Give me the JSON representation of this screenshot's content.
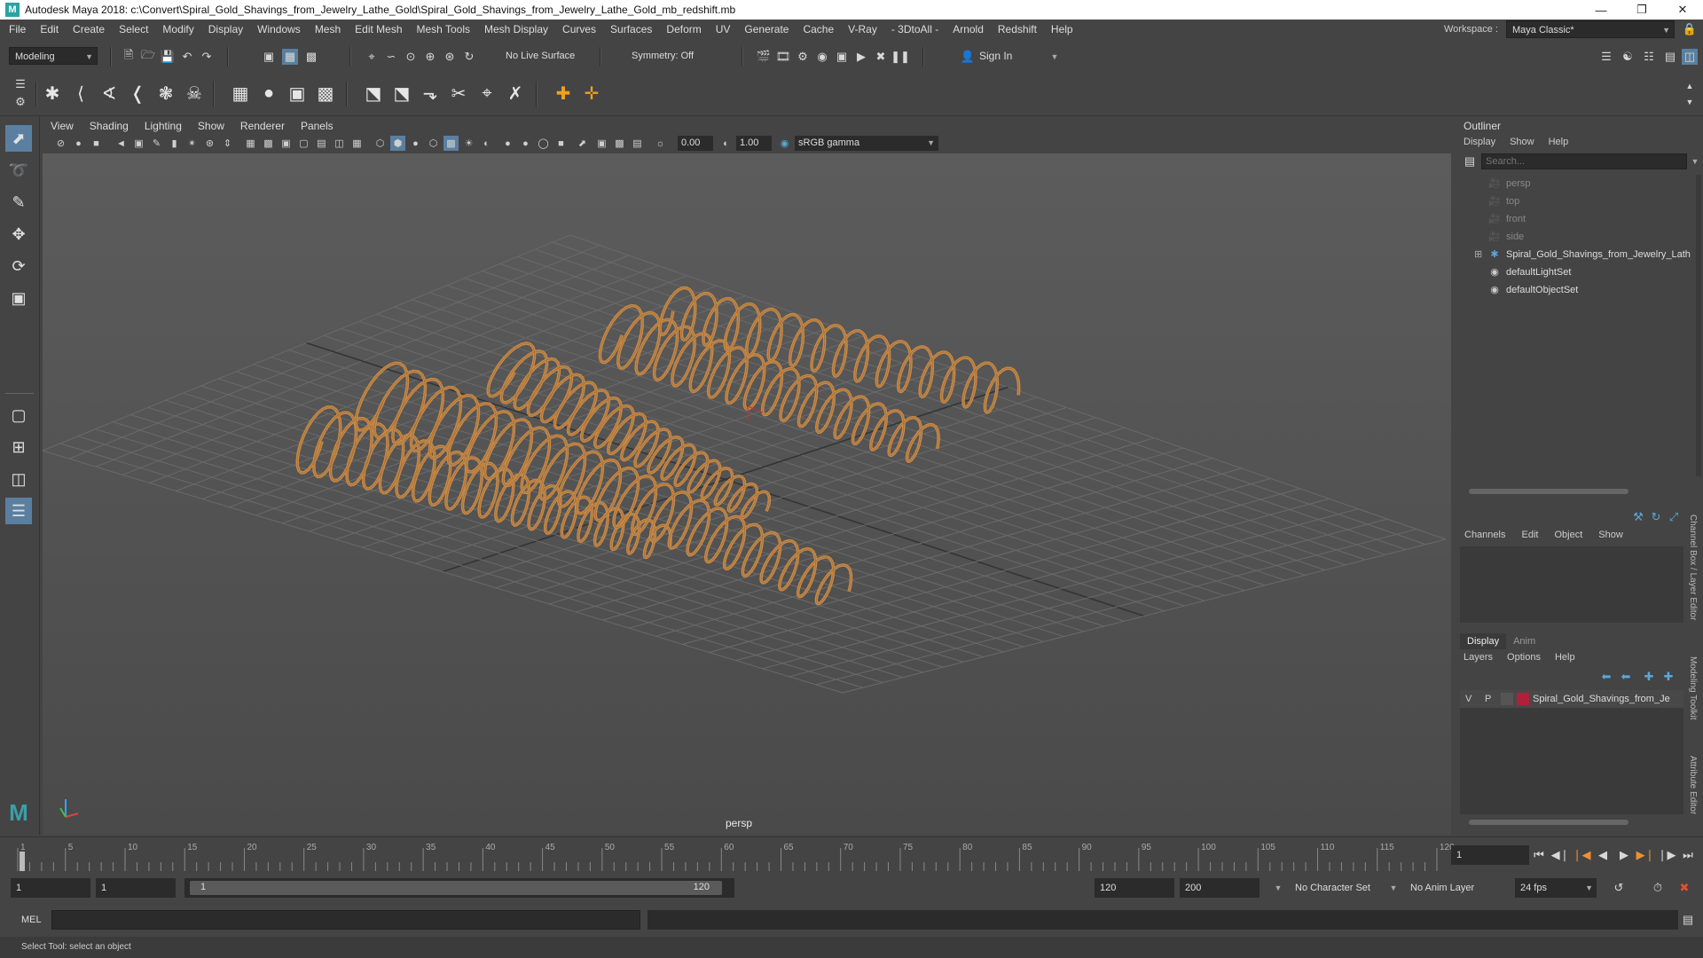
{
  "window": {
    "title": "Autodesk Maya 2018: c:\\Convert\\Spiral_Gold_Shavings_from_Jewelry_Lathe_Gold\\Spiral_Gold_Shavings_from_Jewelry_Lathe_Gold_mb_redshift.mb",
    "logo": "M"
  },
  "menus": [
    "File",
    "Edit",
    "Create",
    "Select",
    "Modify",
    "Display",
    "Windows",
    "Mesh",
    "Edit Mesh",
    "Mesh Tools",
    "Mesh Display",
    "Curves",
    "Surfaces",
    "Deform",
    "UV",
    "Generate",
    "Cache",
    "V-Ray",
    "- 3DtoAll -",
    "Arnold",
    "Redshift",
    "Help"
  ],
  "workspace": {
    "label": "Workspace :",
    "value": "Maya Classic*"
  },
  "status": {
    "mode": "Modeling",
    "live_surface": "No Live Surface",
    "symmetry": "Symmetry: Off",
    "sign_in": "Sign In"
  },
  "viewport": {
    "menus": [
      "View",
      "Shading",
      "Lighting",
      "Show",
      "Renderer",
      "Panels"
    ],
    "exposure": "0.00",
    "gamma": "1.00",
    "colorspace": "sRGB gamma",
    "camera": "persp"
  },
  "outliner": {
    "title": "Outliner",
    "menus": [
      "Display",
      "Show",
      "Help"
    ],
    "search_placeholder": "Search...",
    "items": [
      {
        "label": "persp",
        "icon": "camera-icon"
      },
      {
        "label": "top",
        "icon": "camera-icon"
      },
      {
        "label": "front",
        "icon": "camera-icon"
      },
      {
        "label": "side",
        "icon": "camera-icon"
      },
      {
        "label": "Spiral_Gold_Shavings_from_Jewelry_Lath",
        "icon": "transform-icon"
      },
      {
        "label": "defaultLightSet",
        "icon": "set-icon"
      },
      {
        "label": "defaultObjectSet",
        "icon": "set-icon"
      }
    ]
  },
  "channelbox": {
    "menus": [
      "Channels",
      "Edit",
      "Object",
      "Show"
    ]
  },
  "layers": {
    "tabs": [
      "Display",
      "Anim"
    ],
    "menus": [
      "Layers",
      "Options",
      "Help"
    ],
    "layer": {
      "v": "V",
      "p": "P",
      "name": "Spiral_Gold_Shavings_from_Je",
      "color": "#b0203a"
    }
  },
  "side_tabs": [
    "Channel Box / Layer Editor",
    "Modeling Toolkit",
    "Attribute Editor"
  ],
  "timeline": {
    "ticks": [
      "1",
      "5",
      "10",
      "15",
      "20",
      "25",
      "30",
      "35",
      "40",
      "45",
      "50",
      "55",
      "60",
      "65",
      "70",
      "75",
      "80",
      "85",
      "90",
      "95",
      "100",
      "105",
      "110",
      "115",
      "120"
    ],
    "current_frame": "1"
  },
  "range": {
    "start": "1",
    "playback_start": "1",
    "slider_start": "1",
    "slider_end": "120",
    "playback_end": "120",
    "end": "200",
    "character_set": "No Character Set",
    "anim_layer": "No Anim Layer",
    "fps": "24 fps"
  },
  "command": {
    "lang": "MEL"
  },
  "help": {
    "text": "Select Tool: select an object"
  },
  "colors": {
    "gold": "#c88a48",
    "accent": "#5aa7d6"
  }
}
